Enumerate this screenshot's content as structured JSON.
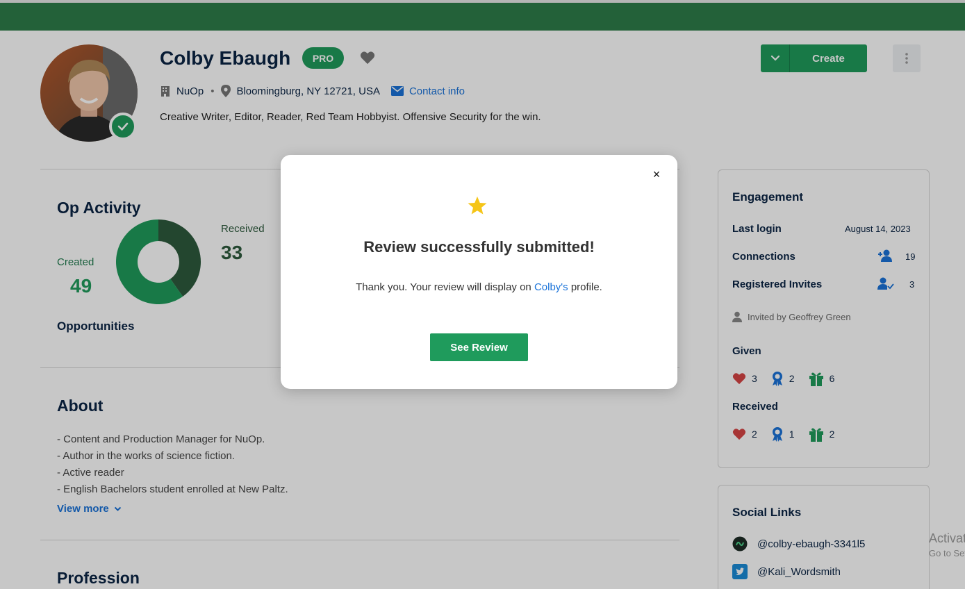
{
  "profile": {
    "name": "Colby Ebaugh",
    "badge": "PRO",
    "company": "NuOp",
    "location": "Bloomingburg, NY 12721, USA",
    "contact_label": "Contact info",
    "bio": "Creative Writer, Editor, Reader, Red Team Hobbyist. Offensive Security for the win."
  },
  "actions": {
    "create_label": "Create"
  },
  "op_activity": {
    "title": "Op Activity",
    "created_label": "Created",
    "created_value": "49",
    "received_label": "Received",
    "received_value": "33",
    "footer": "Opportunities",
    "colors": {
      "created": "#1f9b5c",
      "received": "#2d5a3d"
    }
  },
  "chart_data": {
    "type": "pie",
    "categories": [
      "Created",
      "Received"
    ],
    "values": [
      49,
      33
    ]
  },
  "about": {
    "title": "About",
    "lines": [
      "- Content and Production Manager for NuOp.",
      "- Author in the works of science fiction.",
      "- Active reader",
      "- English Bachelors student enrolled at New Paltz."
    ],
    "view_more": "View more"
  },
  "profession": {
    "title": "Profession"
  },
  "engagement": {
    "title": "Engagement",
    "last_login_label": "Last login",
    "last_login_value": "August 14, 2023",
    "connections_label": "Connections",
    "connections_value": "19",
    "invites_label": "Registered Invites",
    "invites_value": "3",
    "invited_by": "Invited by Geoffrey Green",
    "given_label": "Given",
    "given": {
      "hearts": "3",
      "awards": "2",
      "gifts": "6"
    },
    "received_label": "Received",
    "received": {
      "hearts": "2",
      "awards": "1",
      "gifts": "2"
    }
  },
  "social": {
    "title": "Social Links",
    "links": [
      "@colby-ebaugh-3341l5",
      "@Kali_Wordsmith"
    ]
  },
  "watermark": {
    "line1": "Activate Windows",
    "line2": "Go to Settings to activate Windows."
  },
  "modal": {
    "title": "Review successfully submitted!",
    "msg_prefix": "Thank you. Your review will display on ",
    "msg_link": "Colby's",
    "msg_suffix": " profile.",
    "button": "See Review",
    "close": "×"
  },
  "colors": {
    "brand_green": "#1f9b5c",
    "topbar": "#2e7d4a",
    "navy": "#0b2545",
    "link": "#1a73d9",
    "star": "#f5c518"
  }
}
